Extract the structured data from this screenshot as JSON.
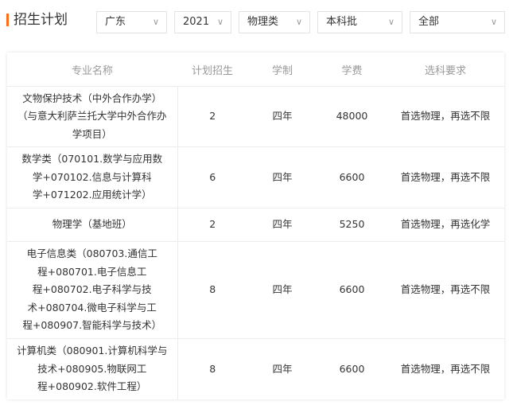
{
  "header": {
    "title": "招生计划"
  },
  "filters": [
    {
      "value": "广东",
      "icon": "chevron-down-icon"
    },
    {
      "value": "2021",
      "icon": "chevron-down-icon"
    },
    {
      "value": "物理类",
      "icon": "chevron-down-icon"
    },
    {
      "value": "本科批",
      "icon": "chevron-down-icon"
    },
    {
      "value": "全部",
      "icon": "chevron-down-icon"
    }
  ],
  "table": {
    "columns": [
      "专业名称",
      "计划招生",
      "学制",
      "学费",
      "选科要求"
    ],
    "rows": [
      {
        "major_lines": [
          "文物保护技术（中外合作办学）",
          "（与意大利萨兰托大学中外合作办",
          "学项目）"
        ],
        "plan": "2",
        "duration": "四年",
        "fee": "48000",
        "requirement": "首选物理，再选不限"
      },
      {
        "major_lines": [
          "数学类（070101.数学与应用数",
          "学+070102.信息与计算科",
          "学+071202.应用统计学）"
        ],
        "plan": "6",
        "duration": "四年",
        "fee": "6600",
        "requirement": "首选物理，再选不限"
      },
      {
        "major_lines": [
          "物理学（基地班）"
        ],
        "plan": "2",
        "duration": "四年",
        "fee": "5250",
        "requirement": "首选物理，再选化学"
      },
      {
        "major_lines": [
          "电子信息类（080703.通信工",
          "程+080701.电子信息工",
          "程+080702.电子科学与技",
          "术+080704.微电子科学与工",
          "程+080907.智能科学与技术）"
        ],
        "plan": "8",
        "duration": "四年",
        "fee": "6600",
        "requirement": "首选物理，再选不限"
      },
      {
        "major_lines": [
          "计算机类（080901.计算机科学与",
          "技术+080905.物联网工",
          "程+080902.软件工程）"
        ],
        "plan": "8",
        "duration": "四年",
        "fee": "6600",
        "requirement": "首选物理，再选不限"
      }
    ]
  }
}
